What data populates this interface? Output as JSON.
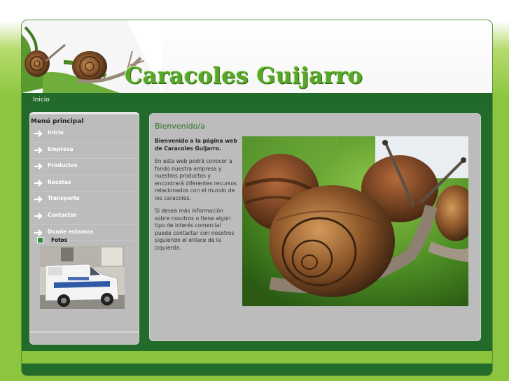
{
  "header": {
    "site_title": "Caracoles Guijarro"
  },
  "topnav": {
    "home_link": "Inicio"
  },
  "sidebar": {
    "title": "Menú principal",
    "items": [
      {
        "label": "Inicio"
      },
      {
        "label": "Empresa"
      },
      {
        "label": "Productos"
      },
      {
        "label": "Recetas"
      },
      {
        "label": "Transporte"
      },
      {
        "label": "Contactar"
      },
      {
        "label": "Donde estamos"
      }
    ],
    "fotos_label": "Fotos"
  },
  "main": {
    "heading": "Bienvenido/a",
    "intro": "Bienvenido a la página web de Caracoles Guijarro.",
    "paragraph1": "En esta web podrá conocer a fondo nuestra empresa y nuestros productos y encontrará diferentes recursos relacionados con el mundo de los caracoles.",
    "paragraph2": "Si desea más información sobre nosotros o tiene algún tipo de interés comercial puede contactar con nosotros siguiendo el enlace de la izquierda."
  },
  "colors": {
    "dark_green": "#236b2b",
    "light_green": "#8cc63f",
    "title_green": "#57a829",
    "panel_gray": "#bcbcbc"
  }
}
